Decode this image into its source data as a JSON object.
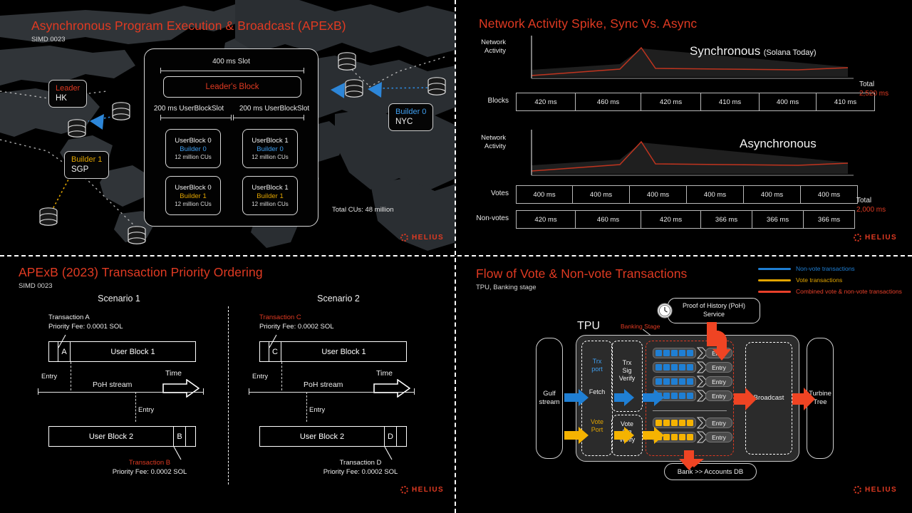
{
  "meta": {
    "brand": "HELIUS",
    "accent": "#e03a22",
    "blue": "#3f9ff0",
    "gold": "#e2a500"
  },
  "panels": {
    "top_left": {
      "title": "Asynchronous Program Execution & Broadcast (APExB)",
      "subtitle": "SIMD 0023",
      "pins": [
        {
          "role": "Leader",
          "city": "HK"
        },
        {
          "role": "Builder 1",
          "city": "SGP"
        },
        {
          "role": "Builder 0",
          "city": "NYC"
        }
      ],
      "slot_label": "400 ms Slot",
      "leaders_block": "Leader's Block",
      "userblockslot_left": "200 ms UserBlockSlot",
      "userblockslot_right": "200 ms UserBlockSlot",
      "userblocks": [
        {
          "name": "UserBlock 0",
          "builder": "Builder 0",
          "cus": "12 million CUs"
        },
        {
          "name": "UserBlock 1",
          "builder": "Builder 0",
          "cus": "12 million CUs"
        },
        {
          "name": "UserBlock 0",
          "builder": "Builder 1",
          "cus": "12 million CUs"
        },
        {
          "name": "UserBlock 1",
          "builder": "Builder 1",
          "cus": "12 million CUs"
        }
      ],
      "total_cus": "Total CUs: 48 million"
    },
    "top_right": {
      "title": "Network Activity Spike, Sync Vs. Async",
      "sync": {
        "axis_label": "Network\nActivity",
        "caption_big": "Synchronous",
        "caption_small": "(Solana Today)",
        "row_label": "Blocks",
        "cells": [
          "420 ms",
          "460 ms",
          "420 ms",
          "410 ms",
          "400 ms",
          "410 ms"
        ],
        "total_label": "Total",
        "total_value": "2,520 ms"
      },
      "async": {
        "axis_label": "Network\nActivity",
        "caption_big": "Asynchronous",
        "caption_small": "",
        "votes_label": "Votes",
        "votes_cells": [
          "400 ms",
          "400 ms",
          "400 ms",
          "400 ms",
          "400 ms",
          "400 ms"
        ],
        "nonvotes_label": "Non-votes",
        "nonvotes_cells": [
          "420 ms",
          "460 ms",
          "420 ms",
          "366 ms",
          "366 ms",
          "366 ms"
        ],
        "total_label": "Total",
        "total_value": "2,000 ms"
      }
    },
    "bottom_left": {
      "title": "APExB (2023) Transaction Priority Ordering",
      "subtitle": "SIMD 0023",
      "scenario1": {
        "heading": "Scenario 1",
        "top_note_line1": "Transaction A",
        "top_note_line2": "Priority Fee: 0.0001 SOL",
        "top_note_highlight": false,
        "tx_top": "A",
        "block_top": "User Block 1",
        "entry_upper": "Entry",
        "poh_stream": "PoH stream",
        "time": "Time",
        "entry_lower": "Entry",
        "block_bottom": "User Block 2",
        "tx_bottom": "B",
        "bottom_note_line1": "Transaction B",
        "bottom_note_line2": "Priority Fee: 0.0002 SOL",
        "bottom_note_highlight": true
      },
      "scenario2": {
        "heading": "Scenario 2",
        "top_note_line1": "Transaction C",
        "top_note_line2": "Priority Fee: 0.0002 SOL",
        "top_note_highlight": true,
        "tx_top": "C",
        "block_top": "User Block 1",
        "entry_upper": "Entry",
        "poh_stream": "PoH stream",
        "time": "Time",
        "entry_lower": "Entry",
        "block_bottom": "User Block 2",
        "tx_bottom": "D",
        "bottom_note_line1": "Transaction D",
        "bottom_note_line2": "Priority Fee: 0.0002 SOL",
        "bottom_note_highlight": false
      }
    },
    "bottom_right": {
      "title": "Flow of Vote & Non-vote Transactions",
      "subtitle": "TPU, Banking stage",
      "legend": [
        {
          "label": "Non-vote transactions",
          "color": "#1f7fd4"
        },
        {
          "label": "Vote transactions",
          "color": "#e2a500"
        },
        {
          "label": "Combined vote & non-vote transactions",
          "color": "#e8402a"
        }
      ],
      "tpu_label": "TPU",
      "banking_stage_label": "Banking Stage",
      "poh_service": "Proof of History (PoH)\nService",
      "gulf_stream": "Gulf\nstream",
      "trx_port": "Trx\nport",
      "fetch": "Fetch",
      "vote_port": "Vote\nPort",
      "trx_sig_verify": "Trx\nSig\nVerify",
      "vote_sig_verify": "Vote\nSig\nVerify",
      "entry_label": "Entry",
      "nonvote_rows": 4,
      "vote_rows": 2,
      "queue_cells": 5,
      "broadcast": "Broadcast",
      "turbine_tree": "Turbine\nTree",
      "bank_accounts_db": "Bank >> Accounts DB"
    }
  }
}
